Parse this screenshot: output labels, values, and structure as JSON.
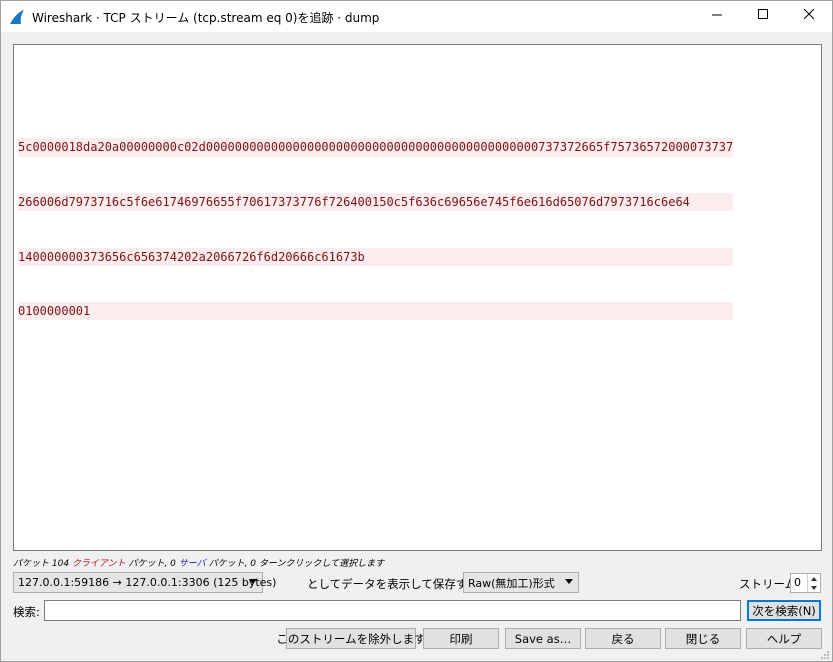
{
  "window": {
    "title": "Wireshark · TCP ストリーム (tcp.stream eq 0)を追跡 · dump"
  },
  "stream": {
    "lines": [
      "5c0000018da20a00000000c02d0000000000000000000000000000000000000000000000737372665f75736572000073737",
      "266006d7973716c5f6e61746976655f70617373776f726400150c5f636c69656e745f6e616d65076d7973716c6e64",
      "140000000373656c656374202a2066726f6d20666c61673b",
      "0100000001"
    ]
  },
  "status": {
    "prefix": "パケット 104",
    "client": "クライアント",
    "mid1": "パケット, 0",
    "server": "サーバ",
    "suffix": "パケット, 0 ターンクリックして選択します"
  },
  "conversation": {
    "selected": "127.0.0.1:59186 → 127.0.0.1:3306 (125 bytes)"
  },
  "show_save_label": "としてデータを表示して保存する",
  "format": {
    "selected": "Raw(無加工)形式"
  },
  "stream_selector": {
    "label": "ストリーム",
    "value": "0"
  },
  "search": {
    "label": "検索:",
    "value": "",
    "find_button": "次を検索(N)"
  },
  "buttons": {
    "exclude": "このストリームを除外します",
    "print": "印刷",
    "save_as": "Save as…",
    "back": "戻る",
    "close": "閉じる",
    "help": "ヘルプ"
  },
  "colors": {
    "client_text": "#7c1417",
    "client_bg": "#fbeded",
    "server_label": "#1a1ab0",
    "default_button_border": "#0078d7"
  }
}
